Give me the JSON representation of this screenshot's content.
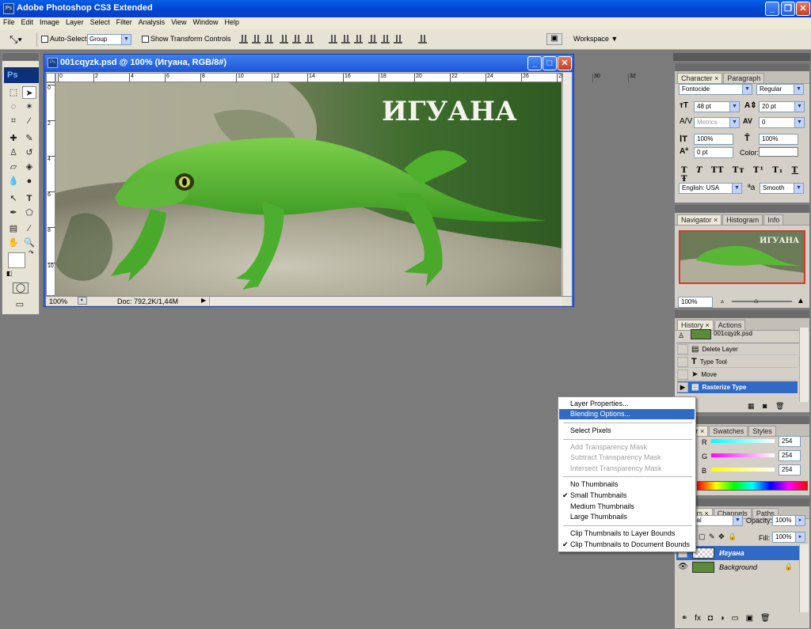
{
  "app": {
    "title": "Adobe Photoshop CS3 Extended",
    "icon": "Ps"
  },
  "menu": [
    "File",
    "Edit",
    "Image",
    "Layer",
    "Select",
    "Filter",
    "Analysis",
    "View",
    "Window",
    "Help"
  ],
  "options_bar": {
    "auto_select_label": "Auto-Select:",
    "auto_select_value": "Group",
    "show_transform_label": "Show Transform Controls",
    "workspace_label": "Workspace"
  },
  "document": {
    "title": "001cqyzk.psd @ 100% (Игуана, RGB/8#)",
    "image_text": "ИГУАНА",
    "zoom": "100%",
    "doc_info": "Doc: 792,2K/1,44M",
    "ruler_top": [
      "0",
      "2",
      "4",
      "6",
      "8",
      "10",
      "12",
      "14",
      "16",
      "18",
      "20",
      "22",
      "24",
      "26",
      "28",
      "30",
      "32"
    ],
    "ruler_left": [
      "0",
      "2",
      "4",
      "6",
      "8",
      "10"
    ]
  },
  "character_panel": {
    "tabs": [
      "Character",
      "Paragraph"
    ],
    "font": "Fontocide",
    "style": "Regular",
    "size": "48 pt",
    "leading": "20 pt",
    "kerning": "Metrics",
    "tracking": "0",
    "vscale": "100%",
    "hscale": "100%",
    "baseline": "0 pt",
    "color_label": "Color:",
    "language": "English: USA",
    "aa_label": "a",
    "aa_value": "Smooth",
    "style_buttons": [
      "T",
      "T",
      "TT",
      "Tт",
      "T¹",
      "T₁",
      "T",
      "Ŧ"
    ]
  },
  "navigator_panel": {
    "tabs": [
      "Navigator",
      "Histogram",
      "Info"
    ],
    "zoom": "100%",
    "thumb_text": "ИГУАНА"
  },
  "history_panel": {
    "tabs": [
      "History",
      "Actions"
    ],
    "snapshot": "001cqyzk.psd",
    "items": [
      "Delete Layer",
      "Type Tool",
      "Move",
      "Rasterize Type"
    ]
  },
  "color_panel": {
    "tabs": [
      "Swatches",
      "Styles"
    ],
    "channels": [
      {
        "label": "R",
        "value": "254"
      },
      {
        "label": "G",
        "value": "254"
      },
      {
        "label": "B",
        "value": "254"
      }
    ]
  },
  "layers_panel": {
    "tabs": [
      "Channels",
      "Paths"
    ],
    "opacity_label": "Opacity:",
    "opacity": "100%",
    "fill_label": "Fill:",
    "fill": "100%",
    "layers": [
      "Игуана",
      "Background"
    ]
  },
  "context_menu": {
    "items": [
      {
        "label": "Layer Properties...",
        "state": "normal"
      },
      {
        "label": "Blending Options...",
        "state": "highlight"
      },
      {
        "label": "Select Pixels",
        "state": "normal"
      },
      {
        "label": "Add Transparency Mask",
        "state": "disabled"
      },
      {
        "label": "Subtract Transparency Mask",
        "state": "disabled"
      },
      {
        "label": "Intersect Transparency Mask",
        "state": "disabled"
      },
      {
        "label": "No Thumbnails",
        "state": "normal"
      },
      {
        "label": "Small Thumbnails",
        "state": "checked"
      },
      {
        "label": "Medium Thumbnails",
        "state": "normal"
      },
      {
        "label": "Large Thumbnails",
        "state": "normal"
      },
      {
        "label": "Clip Thumbnails to Layer Bounds",
        "state": "normal"
      },
      {
        "label": "Clip Thumbnails to Document Bounds",
        "state": "checked"
      }
    ]
  },
  "colors": {
    "titlebar": "#0046d4",
    "highlight": "#316ac5",
    "workspace_bg": "#7b7b7b"
  }
}
